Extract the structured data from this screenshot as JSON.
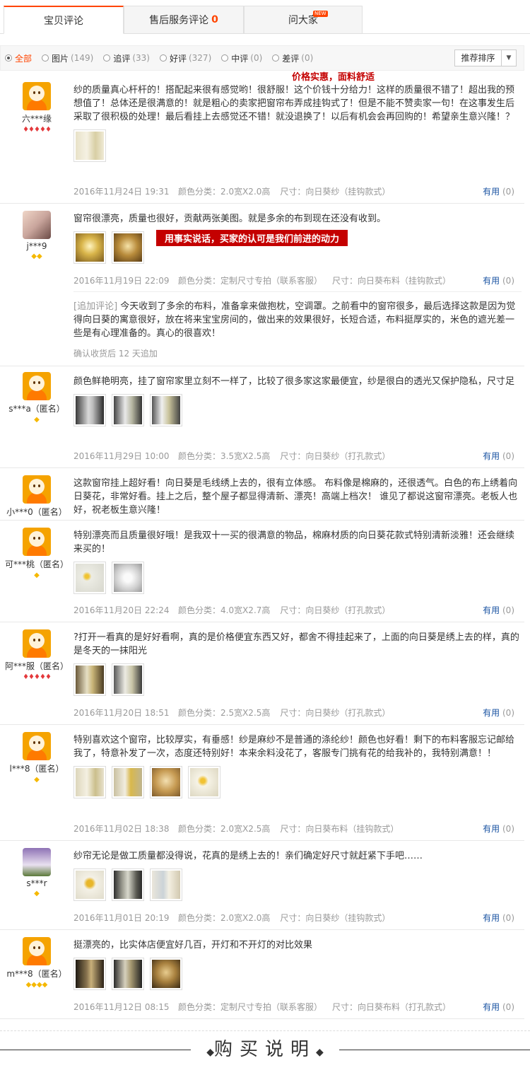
{
  "tabs": [
    {
      "label": "宝贝评论",
      "count": ""
    },
    {
      "label": "售后服务评论",
      "count": "0"
    },
    {
      "label": "问大家",
      "badge": "NEW"
    }
  ],
  "filters": [
    {
      "label": "全部",
      "count": ""
    },
    {
      "label": "图片",
      "count": "(149)"
    },
    {
      "label": "追评",
      "count": "(33)"
    },
    {
      "label": "好评",
      "count": "(327)"
    },
    {
      "label": "中评",
      "count": "(0)"
    },
    {
      "label": "差评",
      "count": "(0)"
    }
  ],
  "sort": {
    "label": "推荐排序"
  },
  "overlays": {
    "price_quality": "价格实惠，面料舒适",
    "facts_speak": "用事实说话，买家的认可是我们前进的动力"
  },
  "useful_label": "有用",
  "useful_count": "(0)",
  "followup_label": "[追加评论]",
  "reviews": [
    {
      "user": "六***缘",
      "badge": "hearts",
      "badge_text": "♦♦♦♦♦",
      "text": "纱的质量真心杆杆的！搭配起来很有感觉哟！很舒服！这个价钱十分给力！这样的质量很不错了！超出我的预想值了！总体还是很满意的！就是粗心的卖家把窗帘布弄成挂钩式了！但是不能不赞卖家一句！在这事发生后采取了很积极的处理！最后看挂上去感觉还不错！就没退换了！以后有机会会再回购的！希望亲生意兴隆！？",
      "date": "2016年11月24日 19:31",
      "color": "颜色分类：2.0宽X2.0高",
      "size": "尺寸：向日葵纱（挂钩款式）"
    },
    {
      "user": "j***9",
      "badge": "diam",
      "badge_text": "◆◆",
      "text": "窗帘很漂亮，质量也很好，贡献两张美图。就是多余的布到现在还没有收到。",
      "date": "2016年11月19日 22:09",
      "color": "颜色分类：定制尺寸专拍（联系客服）",
      "size": "尺寸：向日葵布料（挂钩款式）",
      "followup": "今天收到了多余的布料，准备拿来做抱枕，空调罩。之前看中的窗帘很多，最后选择这款是因为觉得向日葵的寓意很好，放在将来宝宝房间的，做出来的效果很好，长短合适，布料挺厚实的，米色的遮光差一些是有心理准备的。真心的很喜欢！",
      "followup_time": "确认收货后 12 天追加"
    },
    {
      "user": "s***a（匿名）",
      "badge": "diam",
      "badge_text": "◆",
      "text": "颜色鲜艳明亮，挂了窗帘家里立刻不一样了，比较了很多家这家最便宜，纱是很白的透光又保护隐私，尺寸足",
      "date": "2016年11月29日 10:00",
      "color": "颜色分类：3.5宽X2.5高",
      "size": "尺寸：向日葵纱（打孔款式）"
    },
    {
      "user": "小***0（匿名）",
      "badge": "",
      "badge_text": "",
      "text": "这款窗帘挂上超好看！向日葵是毛线绣上去的，很有立体感。 布料像是棉麻的，还很透气。白色的布上绣着向日葵花，非常好看。挂上之后，整个屋子都显得清新、漂亮！高端上档次！ 谁见了都说这窗帘漂亮。老板人也好，祝老板生意兴隆！"
    },
    {
      "user": "可***桃（匿名）",
      "badge": "diam",
      "badge_text": "◆",
      "text": "特别漂亮而且质量很好哦！是我双十一买的很满意的物品，棉麻材质的向日葵花款式特别清新淡雅！还会继续来买的！",
      "date": "2016年11月20日 22:24",
      "color": "颜色分类：4.0宽X2.7高",
      "size": "尺寸：向日葵纱（打孔款式）"
    },
    {
      "user": "阿***服（匿名）",
      "badge": "hearts",
      "badge_text": "♦♦♦♦♦",
      "text": "?打开一看真的是好好看啊，真的是价格便宜东西又好，都舍不得挂起来了，上面的向日葵是绣上去的样，真的是冬天的一抹阳光",
      "date": "2016年11月20日 18:51",
      "color": "颜色分类：2.5宽X2.5高",
      "size": "尺寸：向日葵纱（打孔款式）"
    },
    {
      "user": "l***8（匿名）",
      "badge": "diam",
      "badge_text": "◆",
      "text": "特别喜欢这个窗帘，比较厚实，有垂感！纱是麻纱不是普通的涤纶纱！颜色也好看！剩下的布料客服忘记邮给我了，特意补发了一次，态度还特别好！本来余料没花了，客服专门挑有花的给我补的，我特别满意！！",
      "date": "2016年11月02日 18:38",
      "color": "颜色分类：2.0宽X2.5高",
      "size": "尺寸：向日葵布料（挂钩款式）"
    },
    {
      "user": "s***r",
      "badge": "diam",
      "badge_text": "◆",
      "text": "纱帘无论是做工质量都没得说，花真的是绣上去的！亲们确定好尺寸就赶紧下手吧……",
      "date": "2016年11月01日 20:19",
      "color": "颜色分类：2.0宽X2.0高",
      "size": "尺寸：向日葵纱（挂钩款式）"
    },
    {
      "user": "m***8（匿名）",
      "badge": "diam",
      "badge_text": "◆◆◆◆",
      "text": "挺漂亮的，比实体店便宜好几百，开灯和不开灯的对比效果",
      "date": "2016年11月12日 08:15",
      "color": "颜色分类：定制尺寸专拍（联系客服）",
      "size": "尺寸：向日葵布料（打孔款式）"
    }
  ],
  "footer": {
    "title": "购买说明"
  }
}
